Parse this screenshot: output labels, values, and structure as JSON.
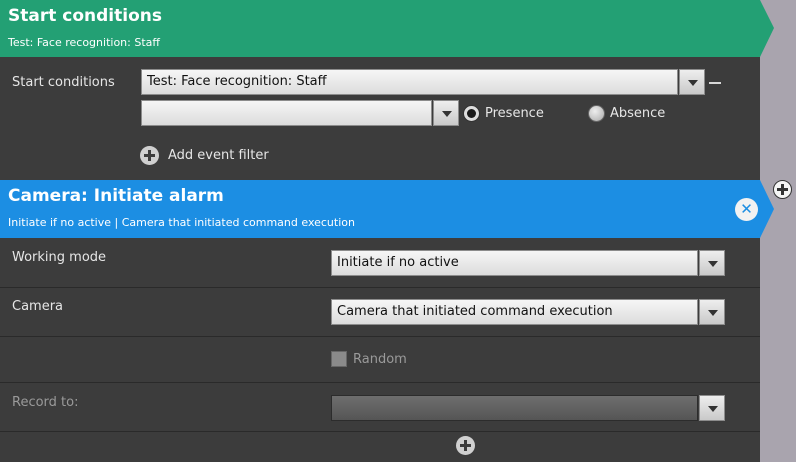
{
  "start_conditions": {
    "header_title": "Start conditions",
    "header_subtitle": "Test: Face recognition: Staff",
    "field_label": "Start conditions",
    "condition_value": "Test: Face recognition: Staff",
    "filter_value": "",
    "presence_label": "Presence",
    "presence_selected": true,
    "absence_label": "Absence",
    "add_event_filter_label": "Add event filter"
  },
  "action": {
    "header_title": "Camera: Initiate alarm",
    "header_subtitle": "Initiate if no active | Camera that initiated command execution",
    "working_mode_label": "Working mode",
    "working_mode_value": "Initiate if no active",
    "camera_label": "Camera",
    "camera_value": "Camera that initiated command execution",
    "random_label": "Random",
    "random_checked": false,
    "record_to_label": "Record to:",
    "record_to_value": ""
  },
  "colors": {
    "start_header": "#23a074",
    "action_header": "#1c8ee3",
    "panel_bg": "#3c3c3c",
    "outer_bg": "#a9a4ae"
  }
}
